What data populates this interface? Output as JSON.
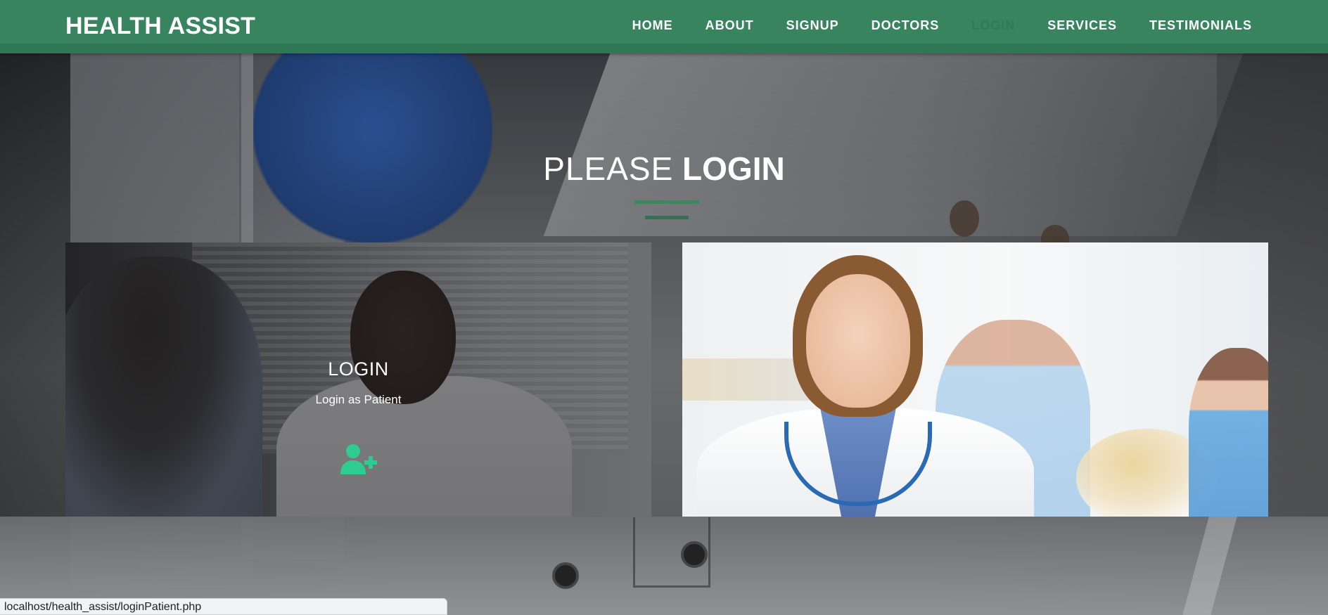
{
  "brand": {
    "name": "HEALTH ASSIST"
  },
  "nav": {
    "items": [
      {
        "label": "HOME",
        "active": false
      },
      {
        "label": "ABOUT",
        "active": false
      },
      {
        "label": "SIGNUP",
        "active": false
      },
      {
        "label": "DOCTORS",
        "active": false
      },
      {
        "label": "LOGIN",
        "active": true
      },
      {
        "label": "SERVICES",
        "active": false
      },
      {
        "label": "TESTIMONIALS",
        "active": false
      }
    ]
  },
  "heading": {
    "light": "PLEASE",
    "bold": "LOGIN"
  },
  "cards": {
    "patient": {
      "title": "LOGIN",
      "subtitle": "Login as Patient",
      "icon": "user-plus-icon"
    },
    "doctor": {
      "image": "smiling-doctor-photo"
    }
  },
  "status": {
    "url": "localhost/health_assist/loginPatient.php"
  },
  "colors": {
    "navbar": "#37845f",
    "navbar_border": "#2f7856",
    "active_nav": "#2f7a58",
    "accent": "#2f8e5e",
    "icon": "#2ecc8f"
  }
}
